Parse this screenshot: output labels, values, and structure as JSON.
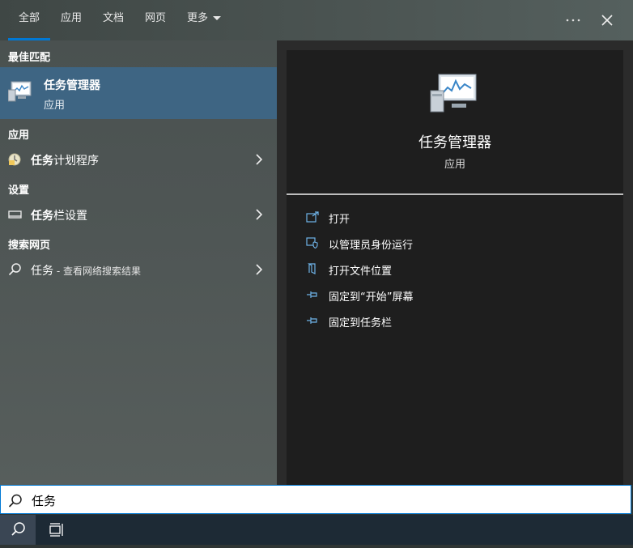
{
  "tabs": [
    {
      "label": "全部"
    },
    {
      "label": "应用"
    },
    {
      "label": "文档"
    },
    {
      "label": "网页"
    },
    {
      "label": "更多"
    }
  ],
  "header": {
    "more_options_icon": "ellipsis-icon",
    "close_icon": "close-icon"
  },
  "left": {
    "best_match_header": "最佳匹配",
    "best_match": {
      "title": "任务管理器",
      "subtitle": "应用",
      "icon": "task-manager-icon"
    },
    "apps_header": "应用",
    "app_item": {
      "label_bold": "任务",
      "label_rest": "计划程序",
      "icon": "task-scheduler-icon"
    },
    "settings_header": "设置",
    "settings_item": {
      "label_bold": "任务",
      "label_rest": "栏设置",
      "icon": "taskbar-icon"
    },
    "web_header": "搜索网页",
    "web_item": {
      "label": "任务",
      "sub": " - 查看网络搜索结果",
      "icon": "search-icon"
    }
  },
  "right": {
    "app_title": "任务管理器",
    "app_subtitle": "应用",
    "actions": [
      {
        "label": "打开",
        "icon": "open-icon"
      },
      {
        "label": "以管理员身份运行",
        "icon": "shield-icon"
      },
      {
        "label": "打开文件位置",
        "icon": "file-location-icon"
      },
      {
        "label": "固定到“开始”屏幕",
        "icon": "pin-icon"
      },
      {
        "label": "固定到任务栏",
        "icon": "pin-icon"
      }
    ]
  },
  "search": {
    "value": "任务",
    "icon": "search-icon"
  },
  "taskbar": {
    "search_icon": "search-icon",
    "task_view_icon": "task-view-icon"
  },
  "colors": {
    "accent": "#0078d4",
    "selected_bg": "#3e6583",
    "icon_blue": "#6fb3e8"
  }
}
